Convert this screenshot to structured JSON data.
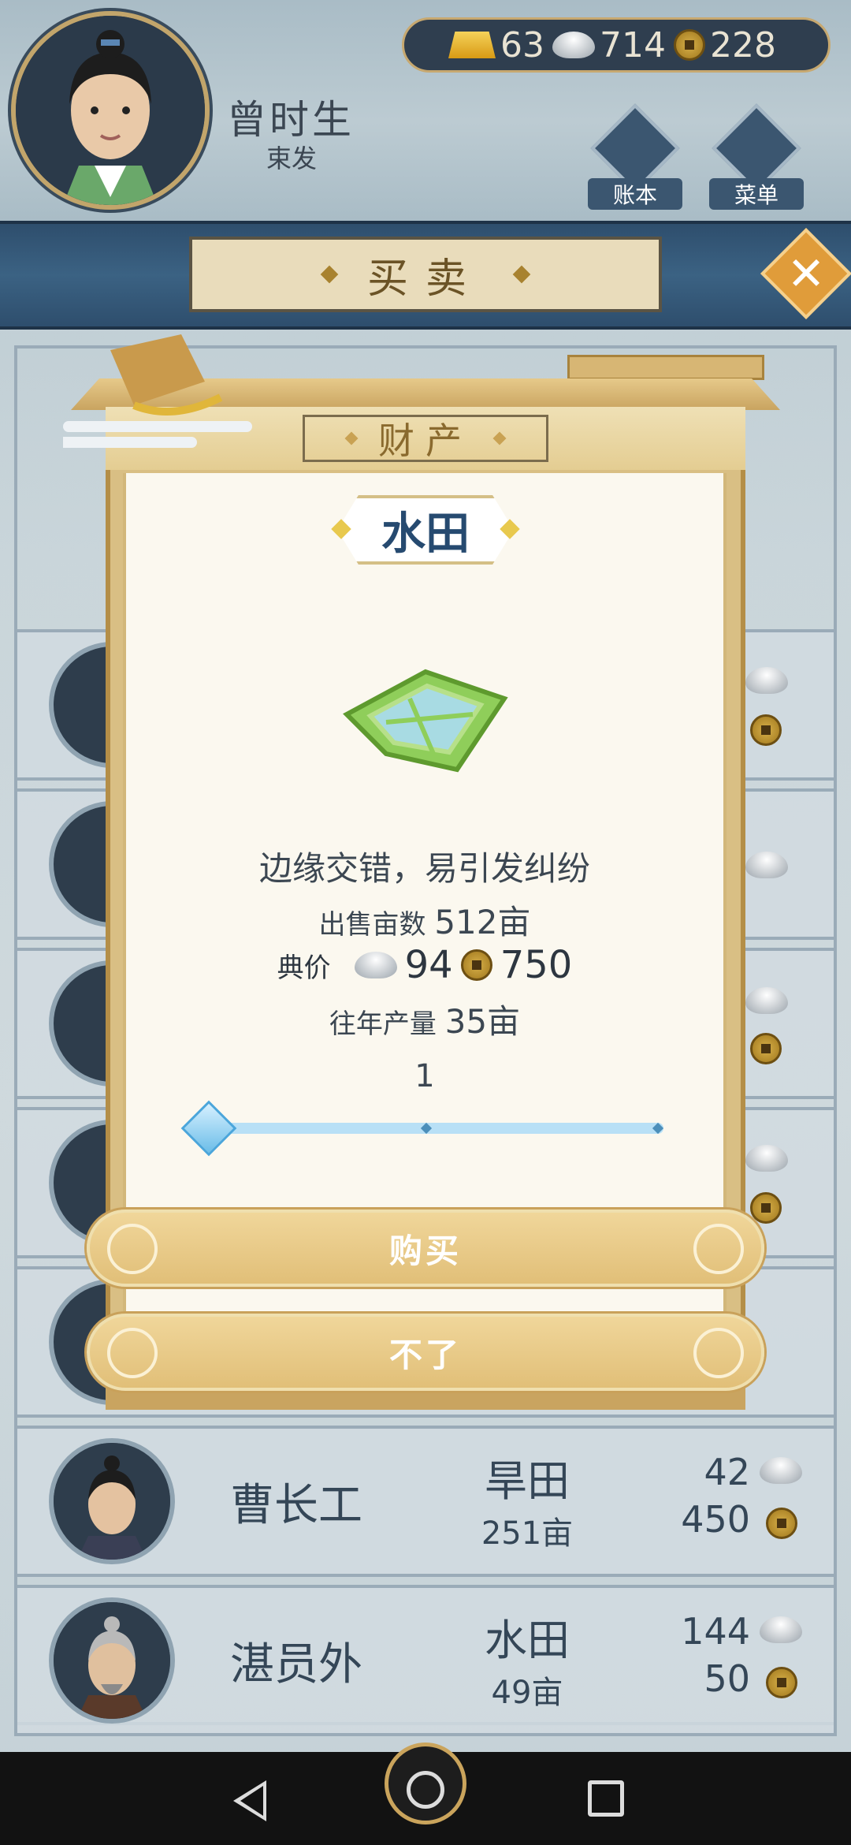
{
  "player": {
    "name": "曾时生",
    "title": "束发"
  },
  "currency": {
    "gold": "63",
    "silver": "714",
    "copper": "228"
  },
  "top_buttons": {
    "ledger_label": "账本",
    "menu_label": "菜单"
  },
  "header": {
    "title": "买卖"
  },
  "modal": {
    "banner_title": "财产",
    "field_name": "水田",
    "description": "边缘交错，易引发纠纷",
    "sale_label": "出售亩数",
    "sale_value": "512亩",
    "price_label": "典价",
    "price_silver": "94",
    "price_copper": "750",
    "yield_label": "往年产量",
    "yield_value": "35亩",
    "quantity": "1",
    "slider_level": 0.0,
    "buy_label": "购买",
    "cancel_label": "不了"
  },
  "list_rows": [
    {
      "name": "曹长工",
      "land": "旱田",
      "area": "251亩",
      "silver": "42",
      "copper": "450"
    },
    {
      "name": "湛员外",
      "land": "水田",
      "area": "49亩",
      "silver": "144",
      "copper": "50"
    }
  ],
  "colors": {
    "accent_gold": "#c9a460",
    "header_blue": "#2e4e6d",
    "slider_blue": "#6bbde8",
    "field_title_blue": "#264a70"
  }
}
